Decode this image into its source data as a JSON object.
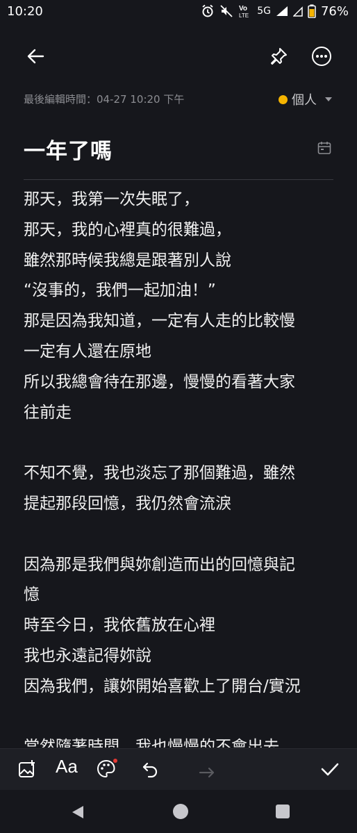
{
  "status": {
    "time": "10:20",
    "network": "5G",
    "volte": "Vo LTE",
    "battery": "76%"
  },
  "header": {
    "back_icon": "arrow-left-icon",
    "pin_icon": "pin-icon",
    "more_icon": "more-icon"
  },
  "meta": {
    "last_edited": "最後編輯時間：04-27 10:20 下午",
    "folder": "個人",
    "folder_color": "#f5b400"
  },
  "note": {
    "title": "一年了嗎",
    "lines": [
      "那天，我第一次失眠了，",
      "那天，我的心裡真的很難過，",
      "雖然那時候我總是跟著別人說",
      "“沒事的，我們一起加油！”",
      "那是因為我知道，一定有人走的比較慢",
      "一定有人還在原地",
      "所以我總會待在那邊，慢慢的看著大家",
      "往前走",
      "",
      "不知不覺，我也淡忘了那個難過，雖然",
      "提起那段回憶，我仍然會流淚",
      "",
      "因為那是我們與妳創造而出的回憶與記",
      "憶",
      "時至今日，我依舊放在心裡",
      "我也永遠記得妳說",
      "因為我們，讓妳開始喜歡上了開台/實況",
      "",
      "當然隨著時間，我也慢慢的不會出去"
    ]
  },
  "toolbar": {
    "items": [
      "image-add-icon",
      "text-format-icon",
      "palette-icon",
      "undo-icon",
      "redo-icon",
      "check-icon"
    ]
  }
}
